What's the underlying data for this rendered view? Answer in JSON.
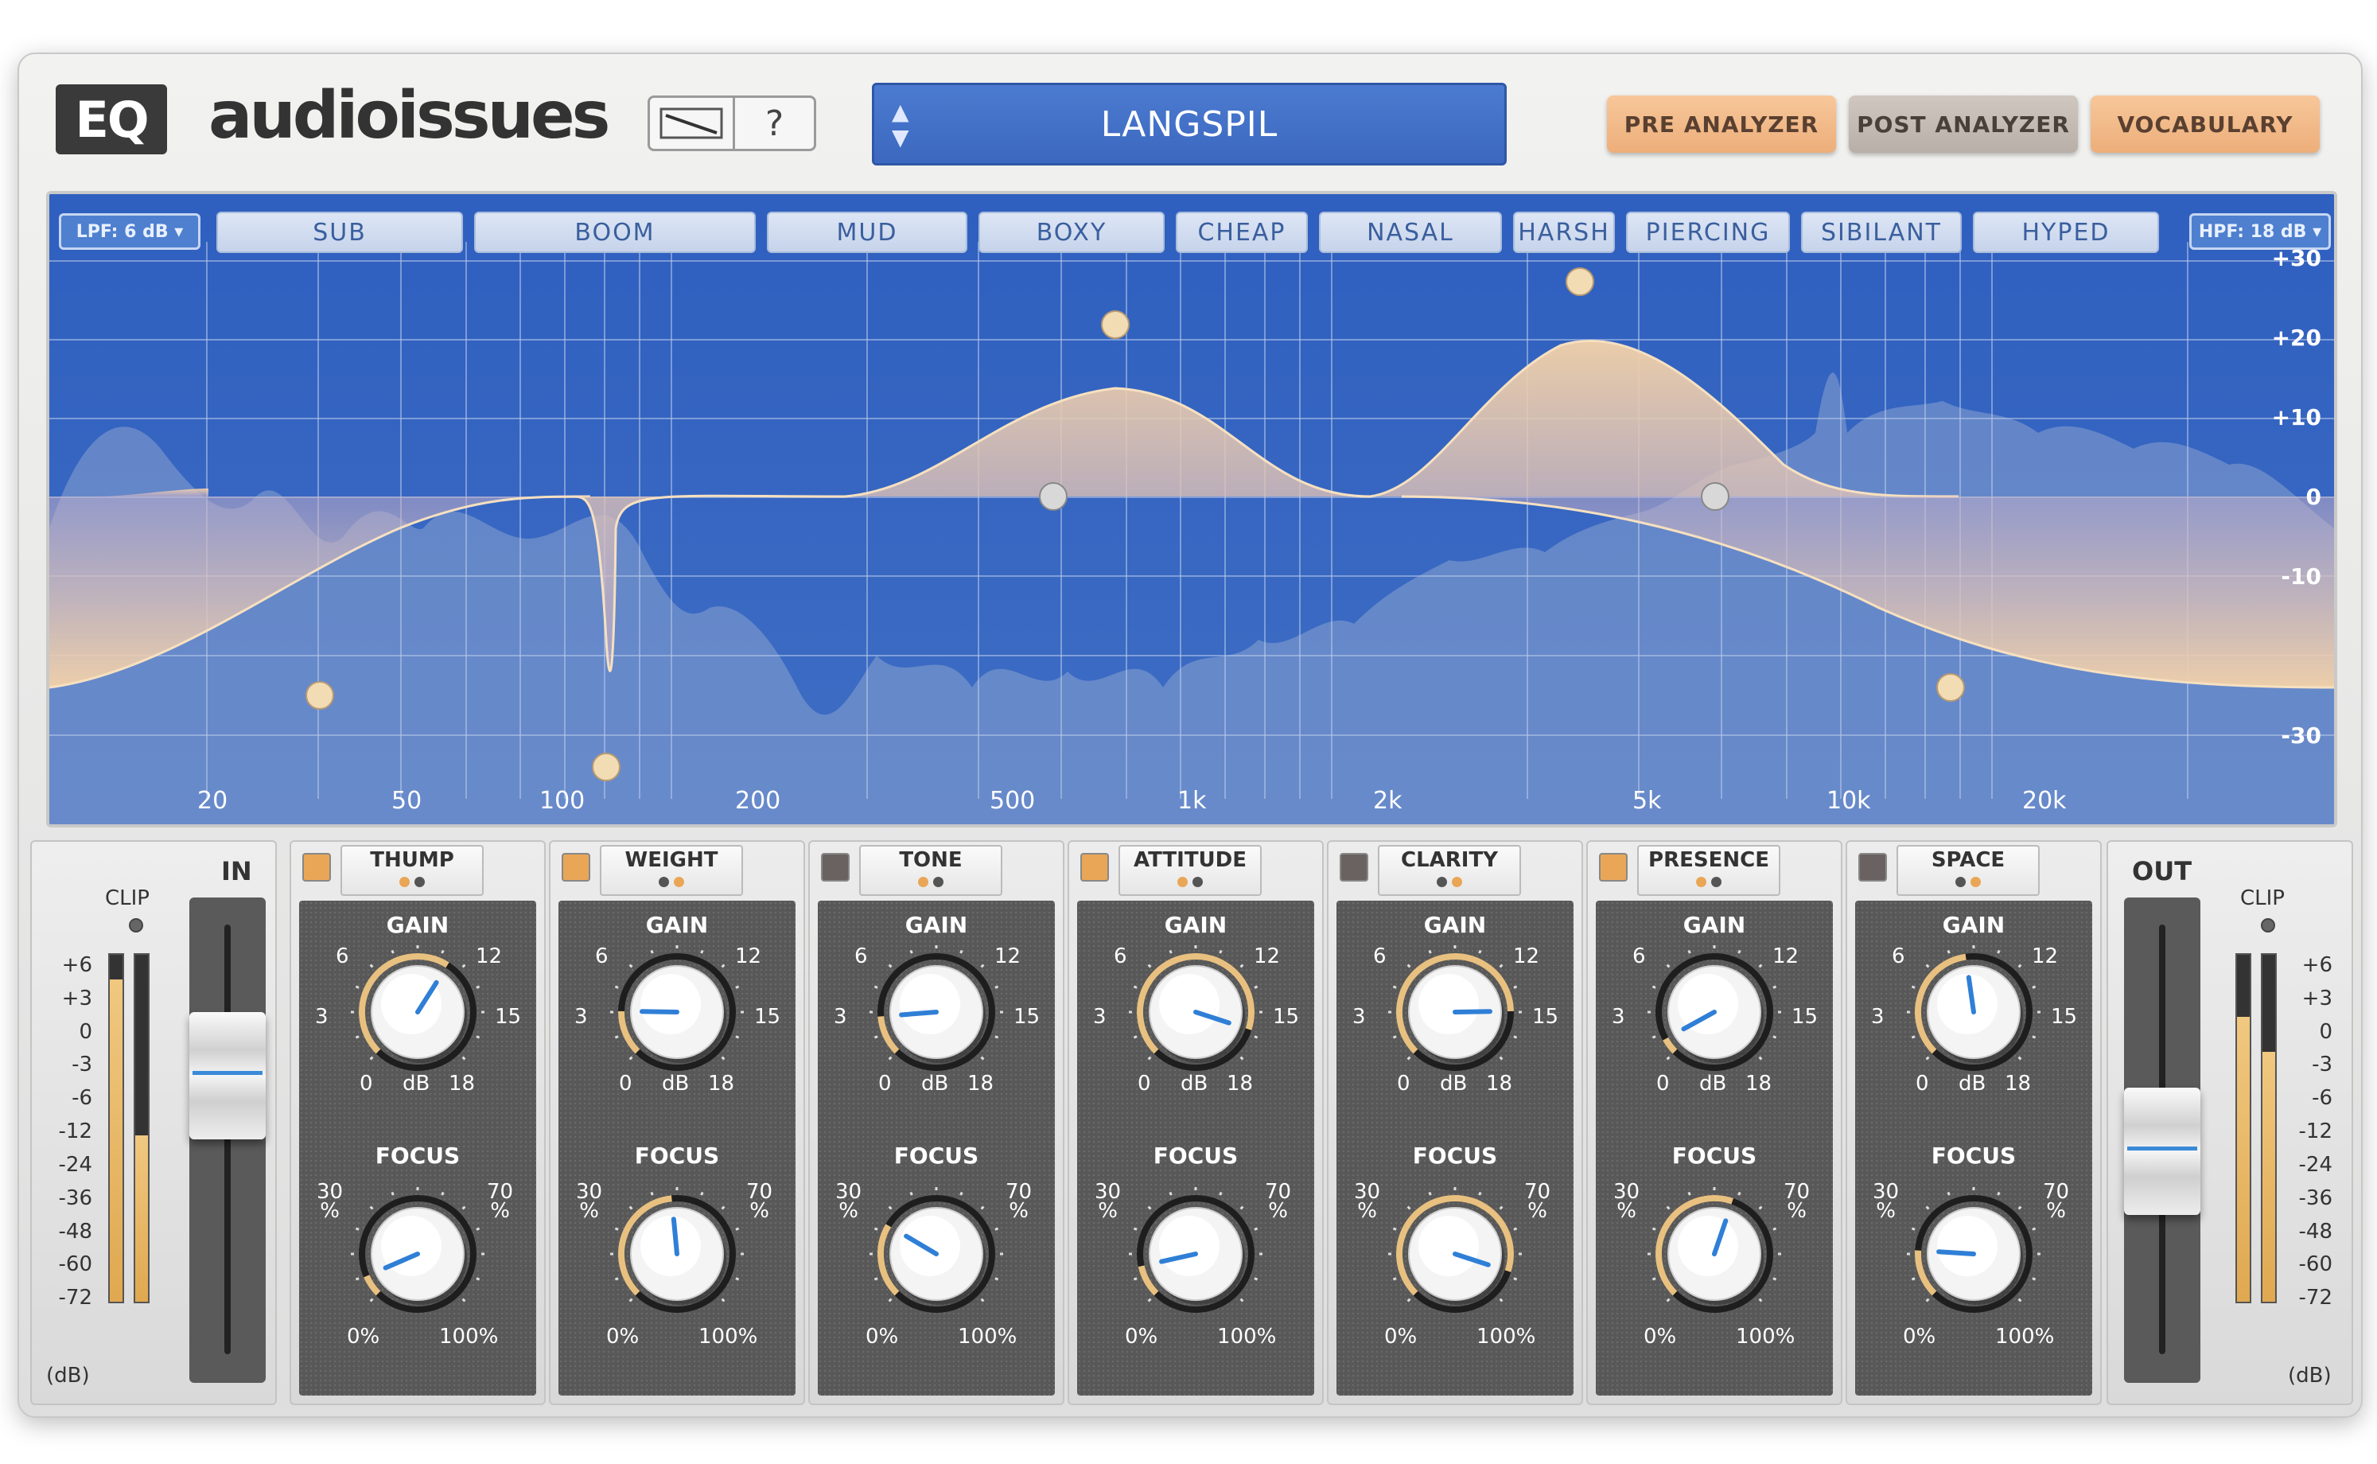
{
  "header": {
    "logo_badge": "EQ",
    "brand": "audioissues",
    "help_label": "?",
    "preset_name": "LANGSPIL",
    "buttons": {
      "pre": "PRE ANALYZER",
      "post": "POST ANALYZER",
      "vocabulary": "VOCABULARY"
    }
  },
  "graph": {
    "lpf": "LPF: 6 dB",
    "hpf": "HPF: 18 dB",
    "vocabulary": [
      "SUB",
      "BOOM",
      "MUD",
      "BOXY",
      "CHEAP",
      "NASAL",
      "HARSH",
      "PIERCING",
      "SIBILANT",
      "HYPED"
    ],
    "db_labels": [
      "+30",
      "+20",
      "+10",
      "0",
      "-10",
      "-30"
    ],
    "hz_labels": [
      "20",
      "50",
      "100",
      "200",
      "500",
      "1k",
      "2k",
      "5k",
      "10k",
      "20k"
    ]
  },
  "input": {
    "title": "IN",
    "clip": "CLIP",
    "unit": "(dB)",
    "scale": [
      "+6",
      "+3",
      "0",
      "-3",
      "-6",
      "-12",
      "-24",
      "-36",
      "-48",
      "-60",
      "-72"
    ],
    "meter_levels": [
      0.93,
      0.48
    ],
    "fader_level": 0.68
  },
  "output": {
    "title": "OUT",
    "clip": "CLIP",
    "unit": "(dB)",
    "scale": [
      "+6",
      "+3",
      "0",
      "-3",
      "-6",
      "-12",
      "-24",
      "-36",
      "-48",
      "-60",
      "-72"
    ],
    "meter_levels": [
      0.82,
      0.72
    ],
    "fader_level": 0.47
  },
  "knob_labels": {
    "gain": "GAIN",
    "focus": "FOCUS",
    "g6": "6",
    "g12": "12",
    "g3": "3",
    "g15": "15",
    "g0": "0",
    "gdb": "dB",
    "g18": "18",
    "f30": "30\n%",
    "f70": "70\n%",
    "f0": "0%",
    "f100": "100%"
  },
  "bands": [
    {
      "name": "THUMP",
      "active": true,
      "dots": [
        "#e9a657",
        "#555"
      ],
      "gain": 0.62,
      "focus": 0.08
    },
    {
      "name": "WEIGHT",
      "active": true,
      "dots": [
        "#555",
        "#e9a657"
      ],
      "gain": 0.17,
      "focus": 0.48
    },
    {
      "name": "TONE",
      "active": false,
      "dots": [
        "#e9a657",
        "#555"
      ],
      "gain": 0.15,
      "focus": 0.28
    },
    {
      "name": "ATTITUDE",
      "active": true,
      "dots": [
        "#e9a657",
        "#555"
      ],
      "gain": 0.9,
      "focus": 0.12
    },
    {
      "name": "CLARITY",
      "active": false,
      "dots": [
        "#555",
        "#e9a657"
      ],
      "gain": 0.83,
      "focus": 0.9
    },
    {
      "name": "PRESENCE",
      "active": true,
      "dots": [
        "#e9a657",
        "#555"
      ],
      "gain": 0.06,
      "focus": 0.57
    },
    {
      "name": "SPACE",
      "active": false,
      "dots": [
        "#555",
        "#e9a657"
      ],
      "gain": 0.47,
      "focus": 0.18
    }
  ],
  "colors": {
    "accent_orange": "#e9a657",
    "graph_blue": "#3564bd",
    "indicator": "#2f7fd6"
  }
}
